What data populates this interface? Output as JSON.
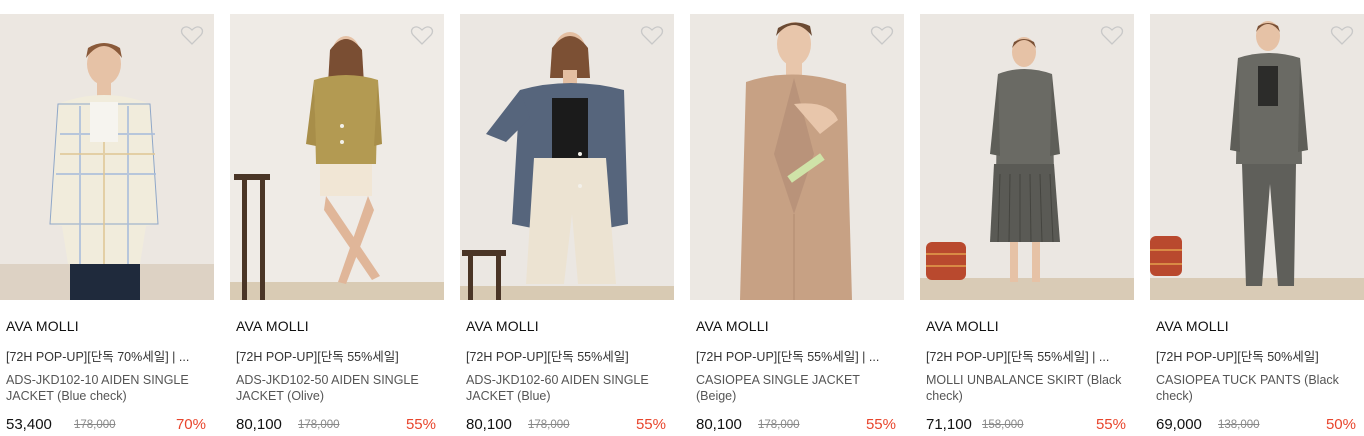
{
  "products": [
    {
      "brand": "AVA MOLLI",
      "tag": "[72H POP-UP][단독 70%세일] | ...",
      "name": "ADS-JKD102-10 AIDEN SINGLE JACKET (Blue check)",
      "price": "53,400",
      "original_price": "178,000",
      "discount": "70%",
      "image": "model-in-blue-check-jacket"
    },
    {
      "brand": "AVA MOLLI",
      "tag": "[72H POP-UP][단독 55%세일]",
      "name": "ADS-JKD102-50 AIDEN SINGLE JACKET (Olive)",
      "price": "80,100",
      "original_price": "178,000",
      "discount": "55%",
      "image": "model-in-olive-jacket"
    },
    {
      "brand": "AVA MOLLI",
      "tag": "[72H POP-UP][단독 55%세일]",
      "name": "ADS-JKD102-60 AIDEN SINGLE JACKET (Blue)",
      "price": "80,100",
      "original_price": "178,000",
      "discount": "55%",
      "image": "model-in-blue-jacket"
    },
    {
      "brand": "AVA MOLLI",
      "tag": "[72H POP-UP][단독 55%세일] | ...",
      "name": "CASIOPEA SINGLE JACKET (Beige)",
      "price": "80,100",
      "original_price": "178,000",
      "discount": "55%",
      "image": "model-in-beige-jacket"
    },
    {
      "brand": "AVA MOLLI",
      "tag": "[72H POP-UP][단독 55%세일] | ...",
      "name": "MOLLI UNBALANCE SKIRT (Black check)",
      "price": "71,100",
      "original_price": "158,000",
      "discount": "55%",
      "image": "model-in-grey-suit-and-pleated-skirt"
    },
    {
      "brand": "AVA MOLLI",
      "tag": "[72H POP-UP][단독 50%세일]",
      "name": "CASIOPEA TUCK PANTS (Black check)",
      "price": "69,000",
      "original_price": "138,000",
      "discount": "50%",
      "image": "model-in-grey-suit-and-pants"
    }
  ],
  "colors": {
    "discount": "#e8452c",
    "heart_outline": "#c8c8c8"
  },
  "icons": {
    "wishlist": "heart-outline-icon"
  }
}
